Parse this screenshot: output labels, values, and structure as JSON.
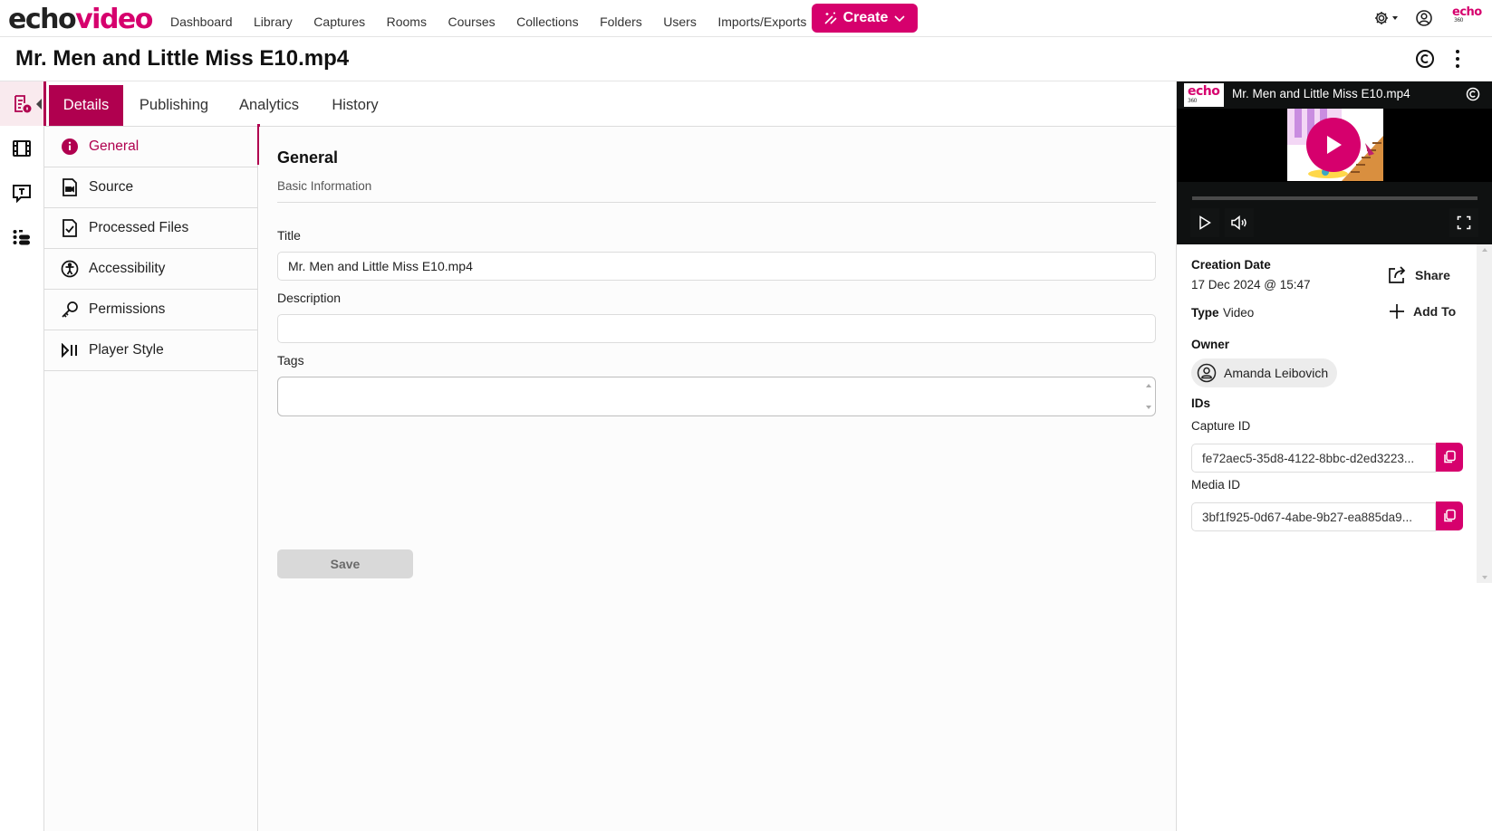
{
  "app": {
    "logo_part1": "echo",
    "logo_part2": "video",
    "brand_color": "#d6006d",
    "accent_color": "#b0004f"
  },
  "topnav": {
    "links": [
      "Dashboard",
      "Library",
      "Captures",
      "Rooms",
      "Courses",
      "Collections",
      "Folders",
      "Users",
      "Imports/Exports"
    ],
    "create_label": "Create",
    "echo360_label": "echo",
    "echo360_sub": "360"
  },
  "page": {
    "title": "Mr. Men and Little Miss E10.mp4"
  },
  "tabs": [
    "Details",
    "Publishing",
    "Analytics",
    "History"
  ],
  "subnav": {
    "items": [
      "General",
      "Source",
      "Processed Files",
      "Accessibility",
      "Permissions",
      "Player Style"
    ]
  },
  "general": {
    "title": "General",
    "subtitle": "Basic Information",
    "title_label": "Title",
    "title_value": "Mr. Men and Little Miss E10.mp4",
    "description_label": "Description",
    "description_value": "",
    "tags_label": "Tags",
    "tags_value": "",
    "save_label": "Save"
  },
  "player": {
    "badge": "echo",
    "badge_sub": "360",
    "title": "Mr. Men and Little Miss E10.mp4",
    "progress": 0
  },
  "meta": {
    "creation_date_label": "Creation Date",
    "creation_date_value": "17 Dec 2024 @ 15:47",
    "type_label": "Type",
    "type_value": "Video",
    "share_label": "Share",
    "add_to_label": "Add To",
    "owner_label": "Owner",
    "owner_name": "Amanda Leibovich",
    "ids_label": "IDs",
    "capture_id_label": "Capture ID",
    "capture_id_value": "fe72aec5-35d8-4122-8bbc-d2ed3223...",
    "media_id_label": "Media ID",
    "media_id_value": "3bf1f925-0d67-4abe-9b27-ea885da9..."
  }
}
